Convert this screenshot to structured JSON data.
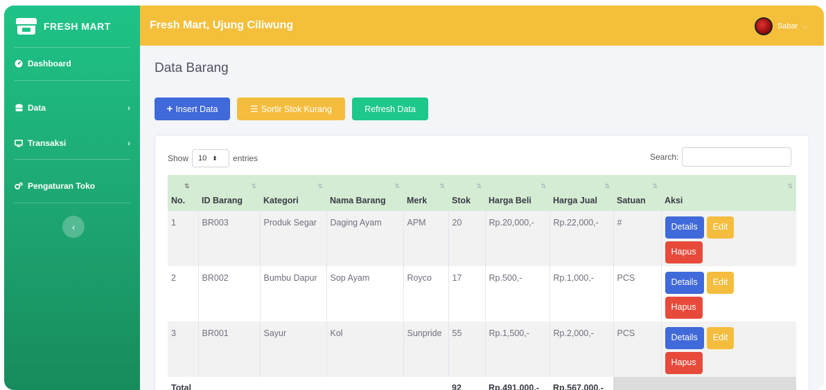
{
  "sidebar": {
    "brand": "FRESH MART",
    "items": [
      {
        "label": "Dashboard",
        "icon": "tachometer-icon"
      },
      {
        "label": "Data",
        "icon": "database-icon",
        "has_submenu": true
      },
      {
        "label": "Transaksi",
        "icon": "monitor-icon",
        "has_submenu": true
      },
      {
        "label": "Pengaturan Toko",
        "icon": "gears-icon"
      }
    ],
    "toggle_icon": "‹"
  },
  "topbar": {
    "store_name": "Fresh Mart, Ujung Ciliwung",
    "user_name": "Sabar"
  },
  "main": {
    "title": "Data Barang",
    "buttons": {
      "insert": "Insert Data",
      "sort": "Sortir Stok Kurang",
      "refresh": "Refresh Data"
    },
    "table_controls": {
      "show_label": "Show",
      "entries_value": "10",
      "entries_label": "entries",
      "search_label": "Search:"
    },
    "table": {
      "headers": [
        "No.",
        "ID Barang",
        "Kategori",
        "Nama Barang",
        "Merk",
        "Stok",
        "Harga Beli",
        "Harga Jual",
        "Satuan",
        "Aksi"
      ],
      "rows": [
        {
          "no": "1",
          "id": "BR003",
          "kategori": "Produk Segar",
          "nama": "Daging Ayam",
          "merk": "APM",
          "stok": "20",
          "beli": "Rp.20,000,-",
          "jual": "Rp.22,000,-",
          "satuan": "#"
        },
        {
          "no": "2",
          "id": "BR002",
          "kategori": "Bumbu Dapur",
          "nama": "Sop Ayam",
          "merk": "Royco",
          "stok": "17",
          "beli": "Rp.500,-",
          "jual": "Rp.1,000,-",
          "satuan": "PCS"
        },
        {
          "no": "3",
          "id": "BR001",
          "kategori": "Sayur",
          "nama": "Kol",
          "merk": "Sunpride",
          "stok": "55",
          "beli": "Rp.1,500,-",
          "jual": "Rp.2,000,-",
          "satuan": "PCS"
        }
      ],
      "actions": {
        "details": "Details",
        "edit": "Edit",
        "hapus": "Hapus"
      },
      "total": {
        "label": "Total",
        "stok": "92",
        "beli": "Rp.491,000,-",
        "jual": "Rp.567,000,-"
      }
    }
  },
  "colors": {
    "sidebar": "#1da571",
    "topbar": "#f4bf3b",
    "primary": "#4069d9",
    "warning": "#f5bd3e",
    "success": "#1dc88a",
    "danger": "#e74a3b",
    "table_header": "#d5ecd4"
  }
}
